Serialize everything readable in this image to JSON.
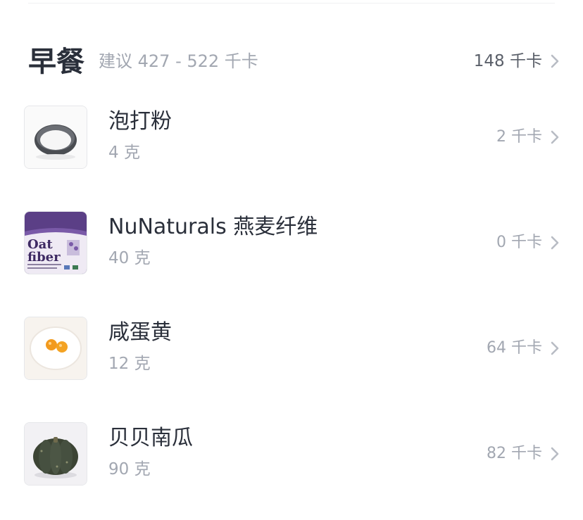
{
  "meal": {
    "title": "早餐",
    "suggestion": "建议 427 - 522 千卡",
    "total": "148 千卡"
  },
  "foods": [
    {
      "name": "泡打粉",
      "amount": "4 克",
      "kcal": "2 千卡",
      "thumbnail_icon": "baking-powder-bowl-icon"
    },
    {
      "name": "NuNaturals 燕麦纤维",
      "amount": "40 克",
      "kcal": "0 千卡",
      "thumbnail_icon": "oat-fiber-package-icon",
      "package_text": [
        "Oat",
        "fiber"
      ]
    },
    {
      "name": "咸蛋黄",
      "amount": "12 克",
      "kcal": "64 千卡",
      "thumbnail_icon": "salted-egg-yolk-plate-icon"
    },
    {
      "name": "贝贝南瓜",
      "amount": "90 克",
      "kcal": "82 千卡",
      "thumbnail_icon": "pumpkin-icon"
    }
  ],
  "colors": {
    "title": "#2a2f3a",
    "secondary_text": "#a2a7b1",
    "total_text": "#5a5f69",
    "chevron": "#b8bcc4",
    "border": "#e6e7ea"
  }
}
